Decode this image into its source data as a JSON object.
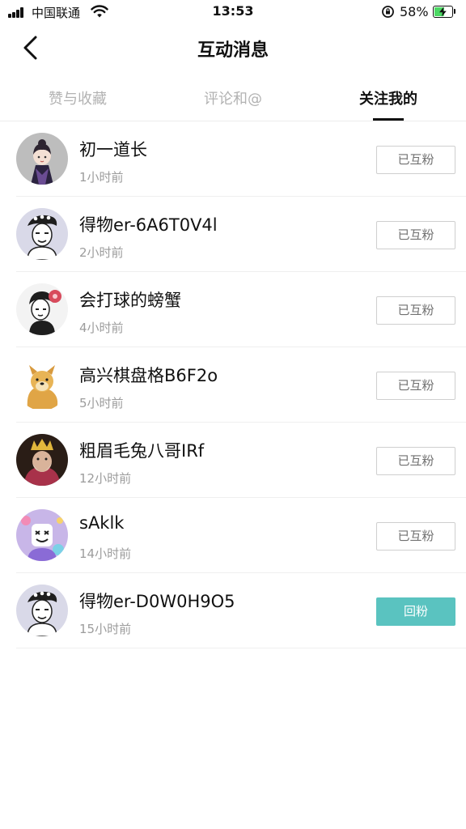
{
  "status_bar": {
    "carrier": "中国联通",
    "time": "13:53",
    "battery": "58%",
    "battery_level": 0.58
  },
  "nav": {
    "title": "互动消息"
  },
  "tabs": [
    {
      "label": "赞与收藏",
      "active": false
    },
    {
      "label": "评论和@",
      "active": false
    },
    {
      "label": "关注我的",
      "active": true
    }
  ],
  "followers": [
    {
      "name": "初一道长",
      "time": "1小时前",
      "button": "已互粉",
      "avatar": "girl-avatar"
    },
    {
      "name": "得物er-6A6T0V4l",
      "time": "2小时前",
      "button": "已互粉",
      "avatar": "default-avatar"
    },
    {
      "name": "会打球的螃蟹",
      "time": "4小时前",
      "button": "已互粉",
      "avatar": "cartoon-avatar"
    },
    {
      "name": "高兴棋盘格B6F2o",
      "time": "5小时前",
      "button": "已互粉",
      "avatar": "dog-avatar"
    },
    {
      "name": "粗眉毛兔八哥IRf",
      "time": "12小时前",
      "button": "已互粉",
      "avatar": "costume-avatar"
    },
    {
      "name": "sAklk",
      "time": "14小时前",
      "button": "已互粉",
      "avatar": "marshmello-avatar"
    },
    {
      "name": "得物er-D0W0H9O5",
      "time": "15小时前",
      "button": "回粉",
      "avatar": "default-avatar"
    }
  ],
  "colors": {
    "accent": "#5ac3c0",
    "battery_green": "#4cd964"
  }
}
